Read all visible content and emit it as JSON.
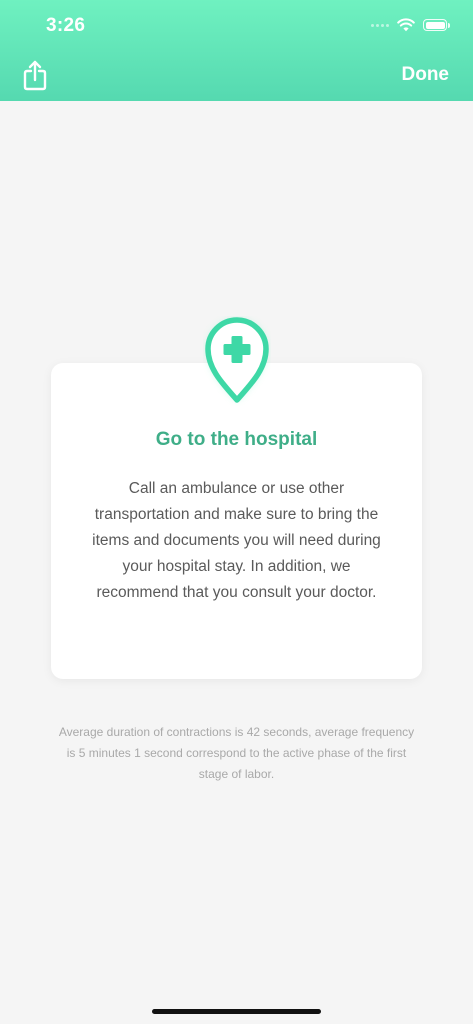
{
  "status_bar": {
    "time": "3:26"
  },
  "nav": {
    "share_icon": "share-icon",
    "done_label": "Done"
  },
  "card": {
    "icon": "hospital-location-pin-icon",
    "title": "Go to the hospital",
    "body": "Call an ambulance or use other transportation and make sure to bring the items and documents you will need during your hospital stay. In addition, we recommend that you consult your doctor."
  },
  "footnote": "Average duration of contractions is 42 seconds, average frequency is 5 minutes 1 second correspond to the active phase of the first stage of labor.",
  "colors": {
    "header_top": "#6ff1c0",
    "header_bottom": "#55d9b0",
    "accent": "#3fae88",
    "pin": "#3ed8a6",
    "background": "#f5f5f5"
  }
}
